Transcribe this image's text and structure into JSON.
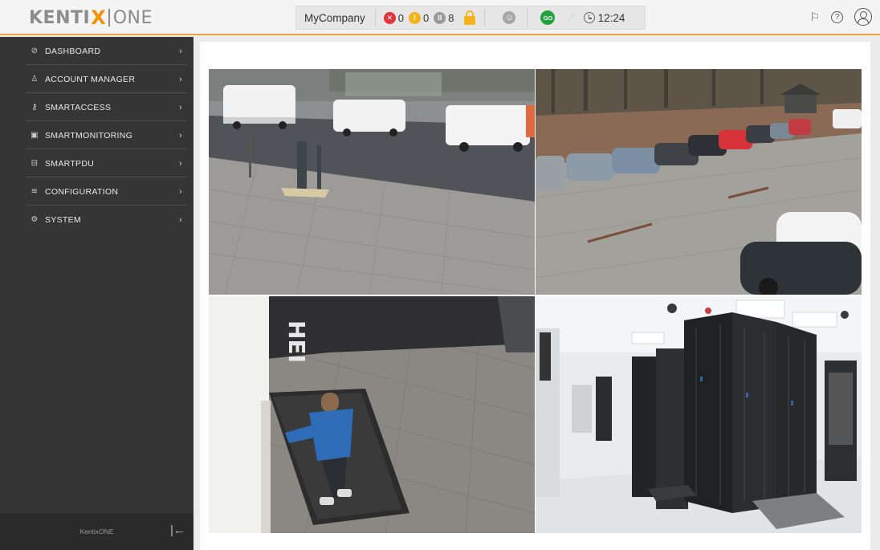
{
  "header": {
    "logo_main": "KENTI",
    "logo_x": "X",
    "logo_suffix": "ONE",
    "company": "MyCompany",
    "alarm_count": "0",
    "warning_count": "0",
    "other_count": "8",
    "go_badge": "GO",
    "time": "12:24"
  },
  "sidebar": {
    "items": [
      {
        "label": "DASHBOARD",
        "icon": "dashboard-icon"
      },
      {
        "label": "ACCOUNT MANAGER",
        "icon": "user-icon"
      },
      {
        "label": "SMARTACCESS",
        "icon": "key-icon"
      },
      {
        "label": "SMARTMONITORING",
        "icon": "monitor-icon"
      },
      {
        "label": "SMARTPDU",
        "icon": "pdu-icon"
      },
      {
        "label": "CONFIGURATION",
        "icon": "sliders-icon"
      },
      {
        "label": "SYSTEM",
        "icon": "gear-icon"
      }
    ],
    "footer_brand": "KentixONE"
  },
  "colors": {
    "accent": "#f39200",
    "sidebar_bg": "#353535",
    "alarm": "#e2343a",
    "warning": "#f6b21a",
    "ok": "#23a33b"
  },
  "cameras": [
    {
      "view": "street-vans"
    },
    {
      "view": "parking-lot"
    },
    {
      "view": "entrance-person"
    },
    {
      "view": "server-room"
    }
  ]
}
